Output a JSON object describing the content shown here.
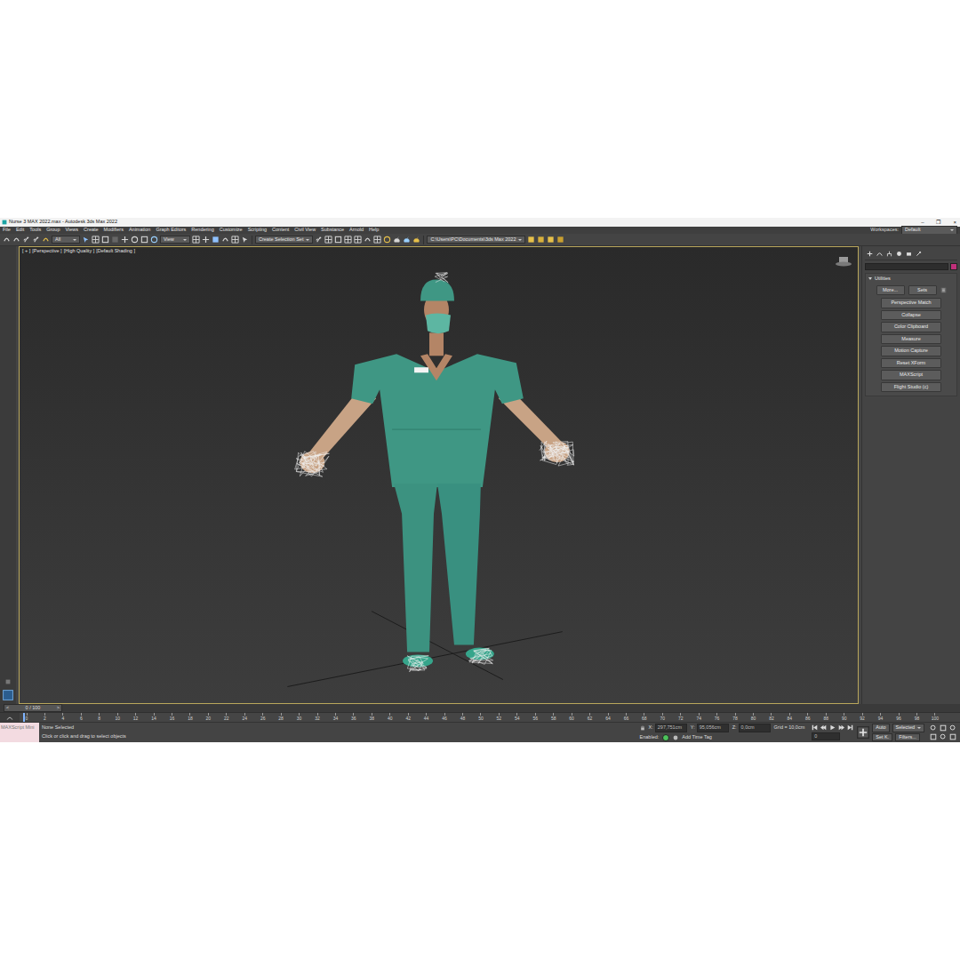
{
  "window": {
    "title": "Nurse 3 MAX 2022.max - Autodesk 3ds Max 2022",
    "controls": [
      "–",
      "❐",
      "×"
    ]
  },
  "menu": [
    "File",
    "Edit",
    "Tools",
    "Group",
    "Views",
    "Create",
    "Modifiers",
    "Animation",
    "Graph Editors",
    "Rendering",
    "Customize",
    "Scripting",
    "Content",
    "Civil View",
    "Substance",
    "Arnold",
    "Help"
  ],
  "workspaces": {
    "label": "Workspaces:",
    "value": "Default"
  },
  "toolbar": {
    "filter": "All",
    "view": "View",
    "selection_set": "Create Selection Set",
    "path": "C:\\Users\\PC\\Documents\\3ds Max 2022"
  },
  "viewport": {
    "labels": [
      "[ + ]",
      "[Perspective ]",
      "[High Quality ]",
      "[Default Shading ]"
    ]
  },
  "command_panel": {
    "rollout": "Utilities",
    "expanded": true,
    "top_buttons": [
      "More...",
      "Sets"
    ],
    "utilities": [
      "Perspective Match",
      "Collapse",
      "Color Clipboard",
      "Measure",
      "Motion Capture",
      "Reset XForm",
      "MAXScript",
      "Flight Studio (c)"
    ]
  },
  "timeline": {
    "prev": "<",
    "frame": "0 / 100",
    "next": ">",
    "level": 0,
    "ticks": [
      "0",
      "2",
      "4",
      "6",
      "8",
      "10",
      "12",
      "14",
      "16",
      "18",
      "20",
      "22",
      "24",
      "26",
      "28",
      "30",
      "32",
      "34",
      "36",
      "38",
      "40",
      "42",
      "44",
      "46",
      "48",
      "50",
      "52",
      "54",
      "56",
      "58",
      "60",
      "62",
      "64",
      "66",
      "68",
      "70",
      "72",
      "74",
      "76",
      "78",
      "80",
      "82",
      "84",
      "86",
      "88",
      "90",
      "92",
      "94",
      "96",
      "98",
      "100"
    ]
  },
  "status_bar": {
    "maxscript": "MAXScript Mini",
    "selection": "None Selected",
    "prompt": "Click or click and drag to select objects",
    "coords": [
      {
        "axis": "X:",
        "value": "297,751cm"
      },
      {
        "axis": "Y:",
        "value": "95,056cm"
      },
      {
        "axis": "Z:",
        "value": "0,0cm"
      }
    ],
    "grid": "Grid = 10,0cm",
    "enabled_label": "Enabled:",
    "enabled": true,
    "time_tag": "Add Time Tag",
    "auto_key": {
      "label": "Auto",
      "on": false
    },
    "key_filter": "Selected",
    "set_key": "Set K.",
    "filters": "Filters...",
    "frame_field": "0"
  }
}
